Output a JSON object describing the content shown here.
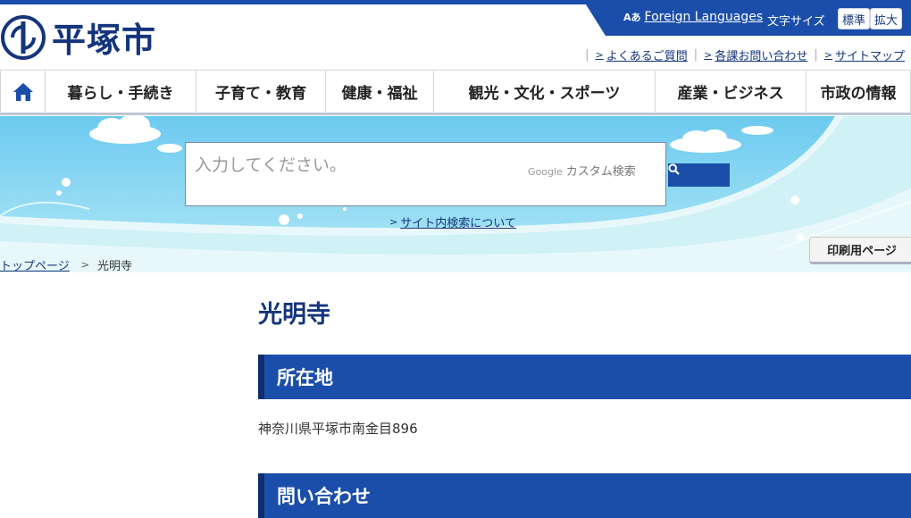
{
  "header": {
    "logo_text": "平塚市",
    "lang_icon": "Aあ",
    "lang_label": "Foreign Languages",
    "font_size_label": "文字サイズ",
    "font_size_standard": "標準",
    "font_size_large": "拡大",
    "sub_links": [
      "よくあるご質問",
      "各課お問い合わせ",
      "サイトマップ"
    ]
  },
  "nav": {
    "home_icon": "home-icon",
    "items": [
      "暮らし・手続き",
      "子育て・教育",
      "健康・福祉",
      "観光・文化・スポーツ",
      "産業・ビジネス",
      "市政の情報"
    ]
  },
  "search": {
    "placeholder": "入力してください。",
    "provider_brand": "Google",
    "provider_label": "カスタム検索",
    "help_link": "サイト内検索について",
    "button_icon": "search-icon"
  },
  "breadcrumb": {
    "home": "トップページ",
    "current": "光明寺"
  },
  "print_button": "印刷用ページ",
  "main": {
    "title": "光明寺",
    "location_heading": "所在地",
    "address": "神奈川県平塚市南金目896",
    "contact_heading": "問い合わせ"
  },
  "colors": {
    "primary": "#1a4eaa",
    "primary_dark": "#14357c",
    "sky": "#7dd3f0"
  }
}
